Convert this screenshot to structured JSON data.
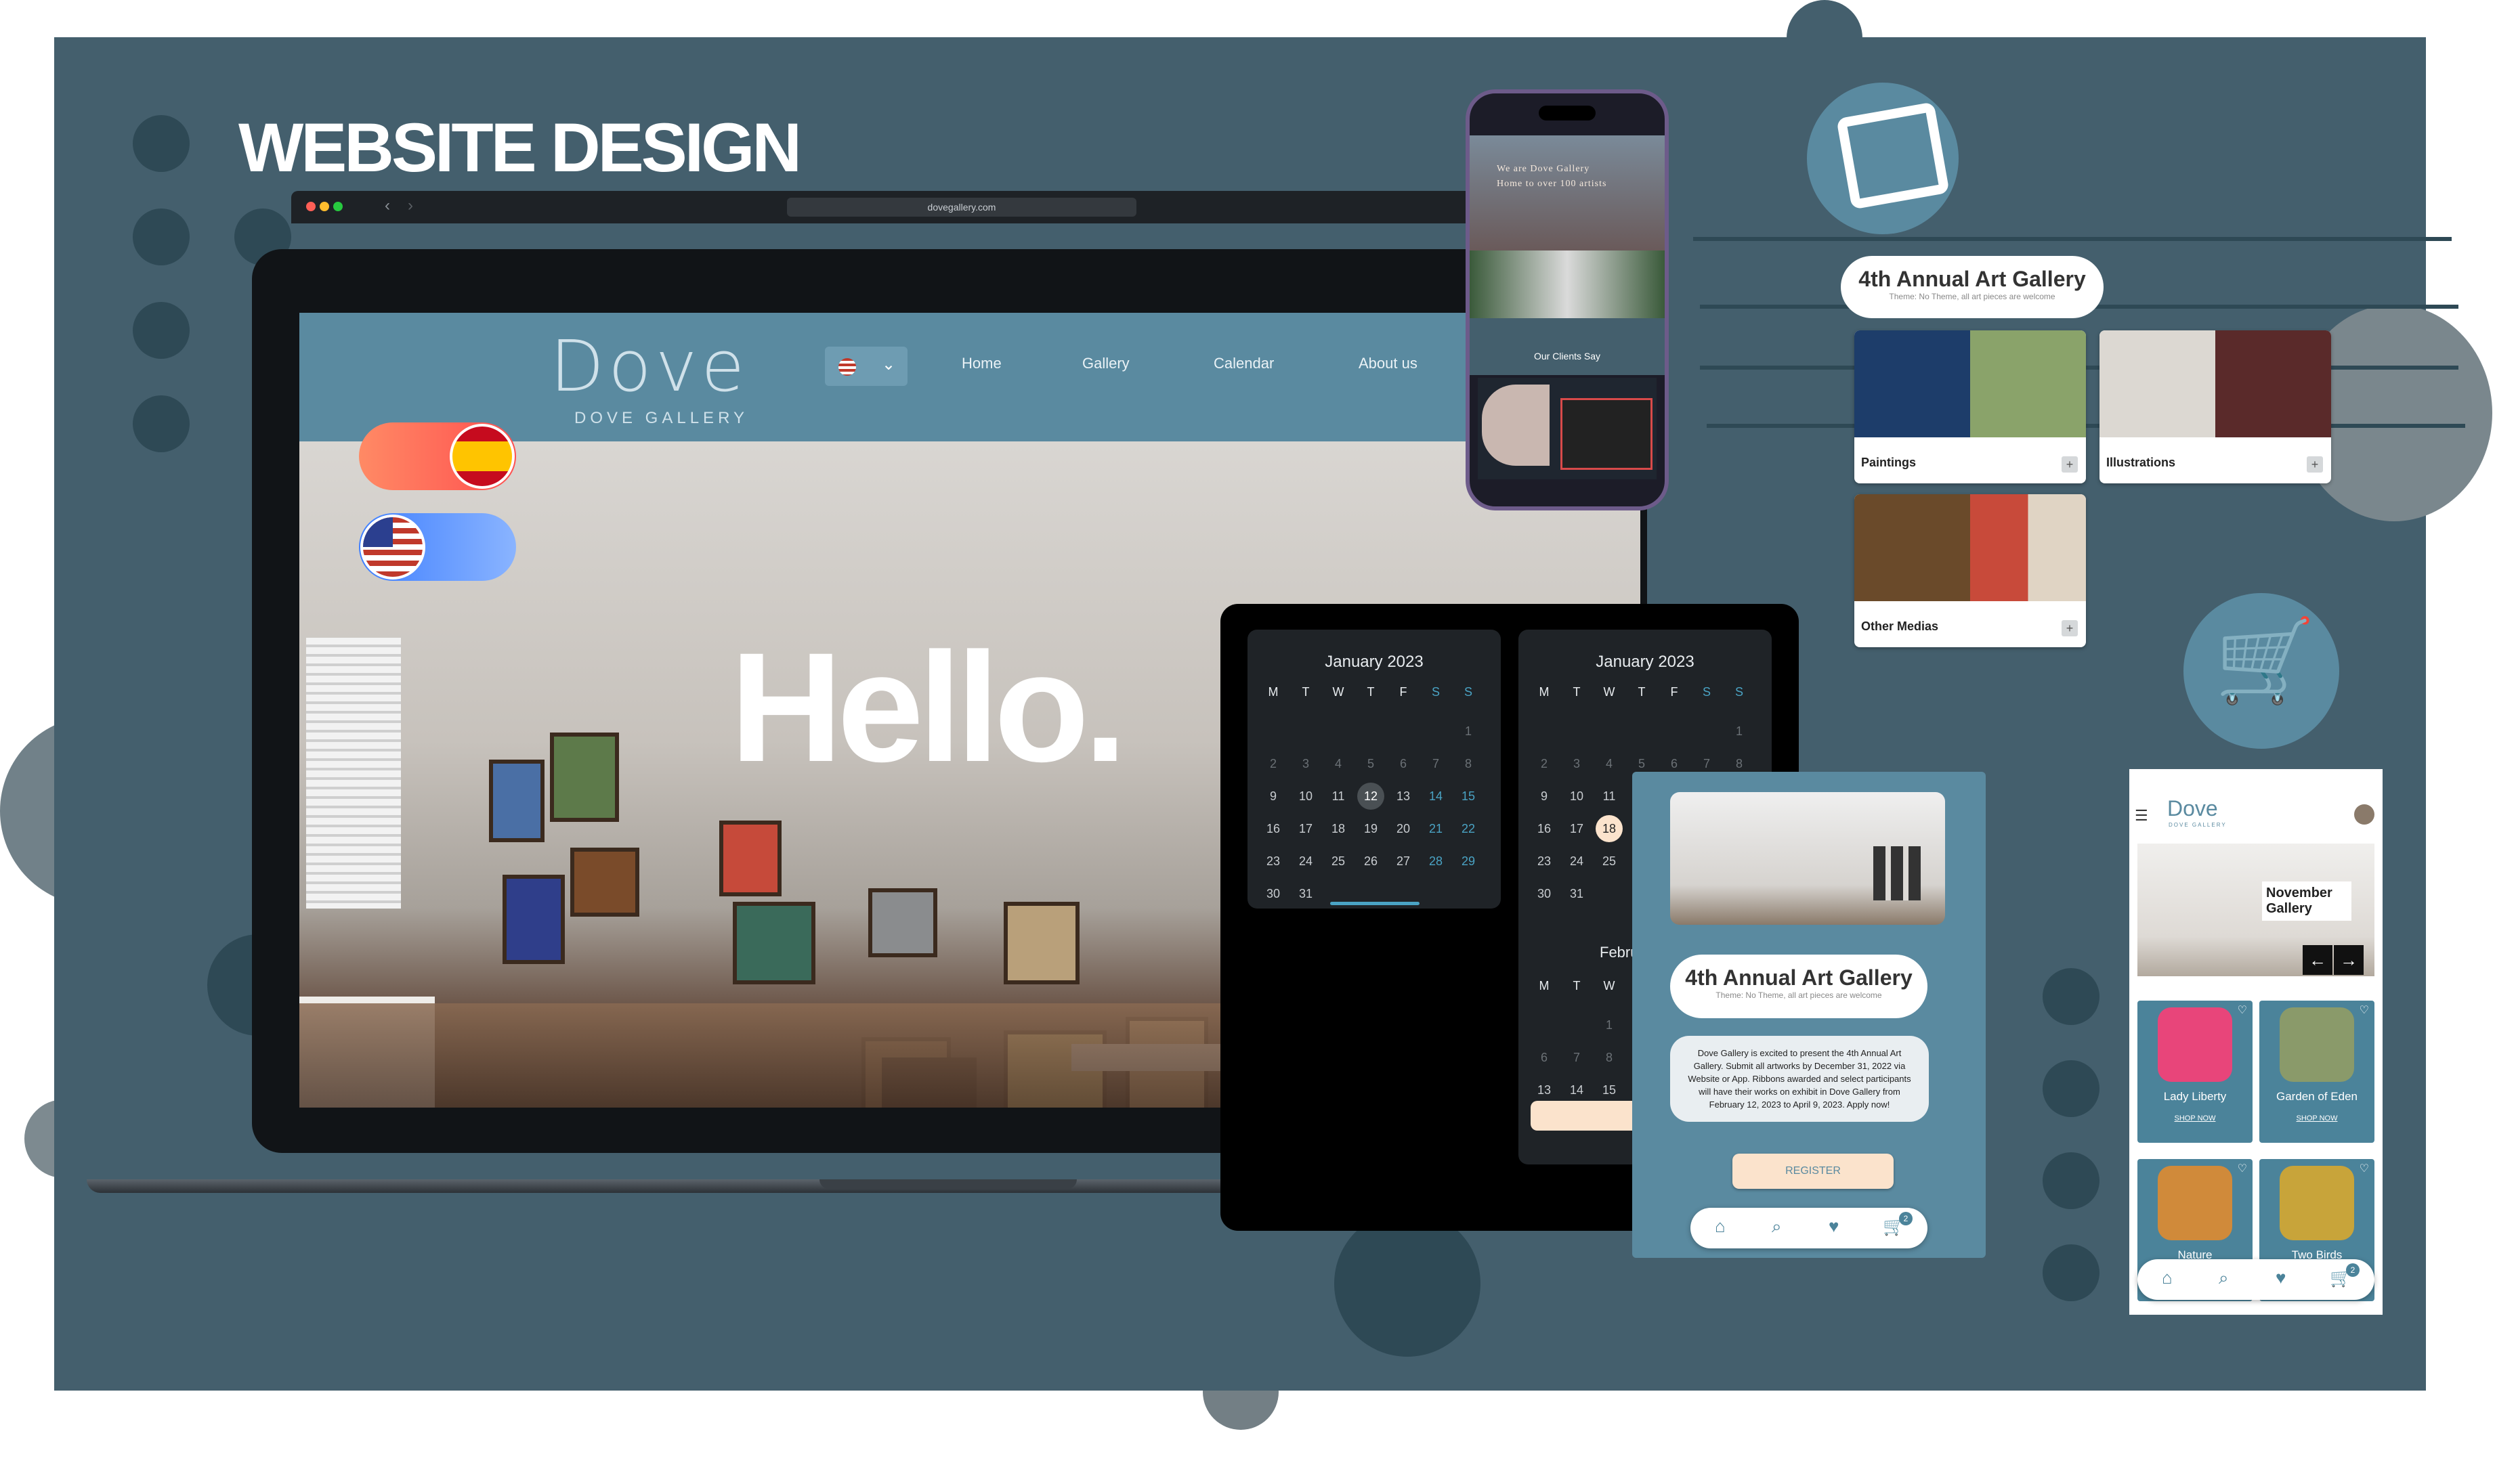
{
  "heading": "WEBSITE DESIGN",
  "browser": {
    "url": "dovegallery.com"
  },
  "site": {
    "logo": "Dove",
    "logo_sub": "DOVE GALLERY",
    "nav": [
      "Home",
      "Gallery",
      "Calendar",
      "About us"
    ],
    "hero_text": "Hello."
  },
  "phone": {
    "hero_line1": "We are Dove Gallery",
    "hero_line2": "Home to over 100 artists",
    "clients_heading": "Our Clients Say"
  },
  "calendar": {
    "left": {
      "title": "January 2023",
      "weekdays": [
        "M",
        "T",
        "W",
        "T",
        "F",
        "S",
        "S"
      ],
      "rows": [
        [
          "",
          "",
          "",
          "",
          "",
          "",
          "1"
        ],
        [
          "2",
          "3",
          "4",
          "5",
          "6",
          "7",
          "8"
        ],
        [
          "9",
          "10",
          "11",
          "12",
          "13",
          "14",
          "15"
        ],
        [
          "16",
          "17",
          "18",
          "19",
          "20",
          "21",
          "22"
        ],
        [
          "23",
          "24",
          "25",
          "26",
          "27",
          "28",
          "29"
        ],
        [
          "30",
          "31",
          "",
          "",
          "",
          "",
          ""
        ]
      ],
      "selected": "12"
    },
    "right": {
      "title": "January 2023",
      "weekdays": [
        "M",
        "T",
        "W",
        "T",
        "F",
        "S",
        "S"
      ],
      "rows": [
        [
          "",
          "",
          "",
          "",
          "",
          "",
          "1"
        ],
        [
          "2",
          "3",
          "4",
          "5",
          "6",
          "7",
          "8"
        ],
        [
          "9",
          "10",
          "11",
          "",
          "",
          "",
          ""
        ],
        [
          "16",
          "17",
          "18",
          "",
          "",
          "",
          ""
        ],
        [
          "23",
          "24",
          "25",
          "",
          "",
          "",
          ""
        ],
        [
          "30",
          "31",
          "",
          "",
          "",
          "",
          ""
        ]
      ],
      "selected": "18",
      "next_month_label": "Febru",
      "next_weekdays": [
        "M",
        "T",
        "W"
      ],
      "next_rows": [
        [
          "",
          "",
          "1"
        ],
        [
          "6",
          "7",
          "8"
        ],
        [
          "13",
          "14",
          "15"
        ]
      ]
    }
  },
  "gallery_panel": {
    "pill_title": "4th Annual Art Gallery",
    "pill_sub": "Theme: No Theme, all art pieces are welcome",
    "cards": [
      "Paintings",
      "Illustrations",
      "Other Medias"
    ]
  },
  "tablet": {
    "pill_title": "4th Annual Art Gallery",
    "pill_sub": "Theme: No Theme, all art pieces are welcome",
    "body": "Dove Gallery is excited to present the 4th Annual Art Gallery. Submit all artworks by December 31, 2022 via Website or App. Ribbons awarded and select participants will have their works on exhibit in Dove Gallery from February 12, 2023 to April 9, 2023. Apply now!",
    "button": "REGISTER",
    "cart_count": "2"
  },
  "mobile_shop": {
    "logo": "Dove",
    "logo_sub": "DOVE GALLERY",
    "banner": "November Gallery",
    "items": [
      {
        "name": "Lady Liberty",
        "cta": "SHOP NOW"
      },
      {
        "name": "Garden of Eden",
        "cta": "SHOP NOW"
      },
      {
        "name": "Nature",
        "cta": ""
      },
      {
        "name": "Two Birds",
        "cta": ""
      }
    ],
    "cart_count": "2"
  },
  "colors": {
    "panel": "#445f6d",
    "accent": "#5a8aa0",
    "cream": "#fbe3cc"
  }
}
